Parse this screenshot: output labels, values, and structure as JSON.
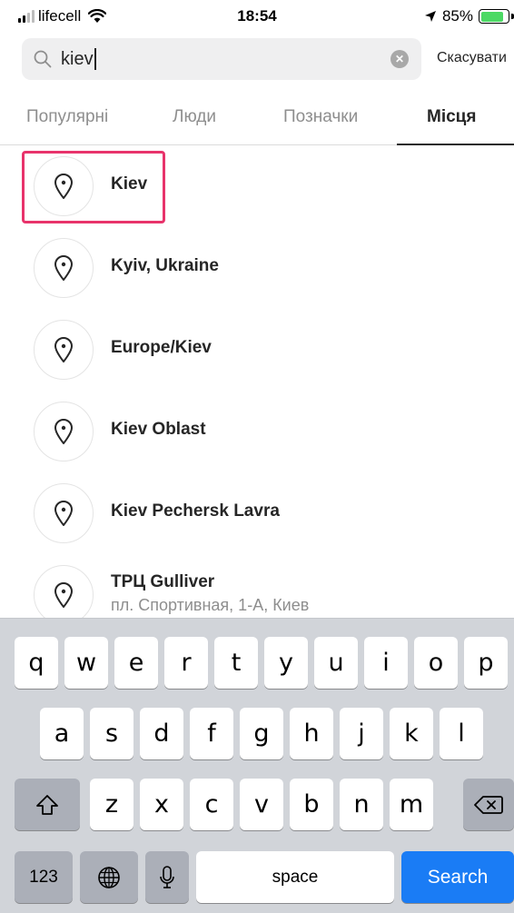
{
  "status_bar": {
    "carrier": "lifecell",
    "time": "18:54",
    "battery": "85%"
  },
  "search": {
    "query": "kiev",
    "cancel_label": "Скасувати"
  },
  "tabs": [
    {
      "label": "Популярні",
      "active": false
    },
    {
      "label": "Люди",
      "active": false
    },
    {
      "label": "Позначки",
      "active": false
    },
    {
      "label": "Місця",
      "active": true
    }
  ],
  "results": [
    {
      "name": "Kiev",
      "highlighted": true
    },
    {
      "name": "Kyiv, Ukraine"
    },
    {
      "name": "Europe/Kiev"
    },
    {
      "name": "Kiev Oblast"
    },
    {
      "name": "Kiev Pechersk Lavra"
    },
    {
      "name": "ТРЦ Gulliver",
      "subtitle": "пл. Спортивная, 1-А, Киев"
    }
  ],
  "keyboard": {
    "row1": [
      "q",
      "w",
      "e",
      "r",
      "t",
      "y",
      "u",
      "i",
      "o",
      "p"
    ],
    "row2": [
      "a",
      "s",
      "d",
      "f",
      "g",
      "h",
      "j",
      "k",
      "l"
    ],
    "row3": [
      "z",
      "x",
      "c",
      "v",
      "b",
      "n",
      "m"
    ],
    "numbers_label": "123",
    "space_label": "space",
    "search_label": "Search"
  },
  "colors": {
    "highlight_border": "#e8336b",
    "search_key": "#1a7cf5",
    "battery_fill": "#4cd964"
  }
}
